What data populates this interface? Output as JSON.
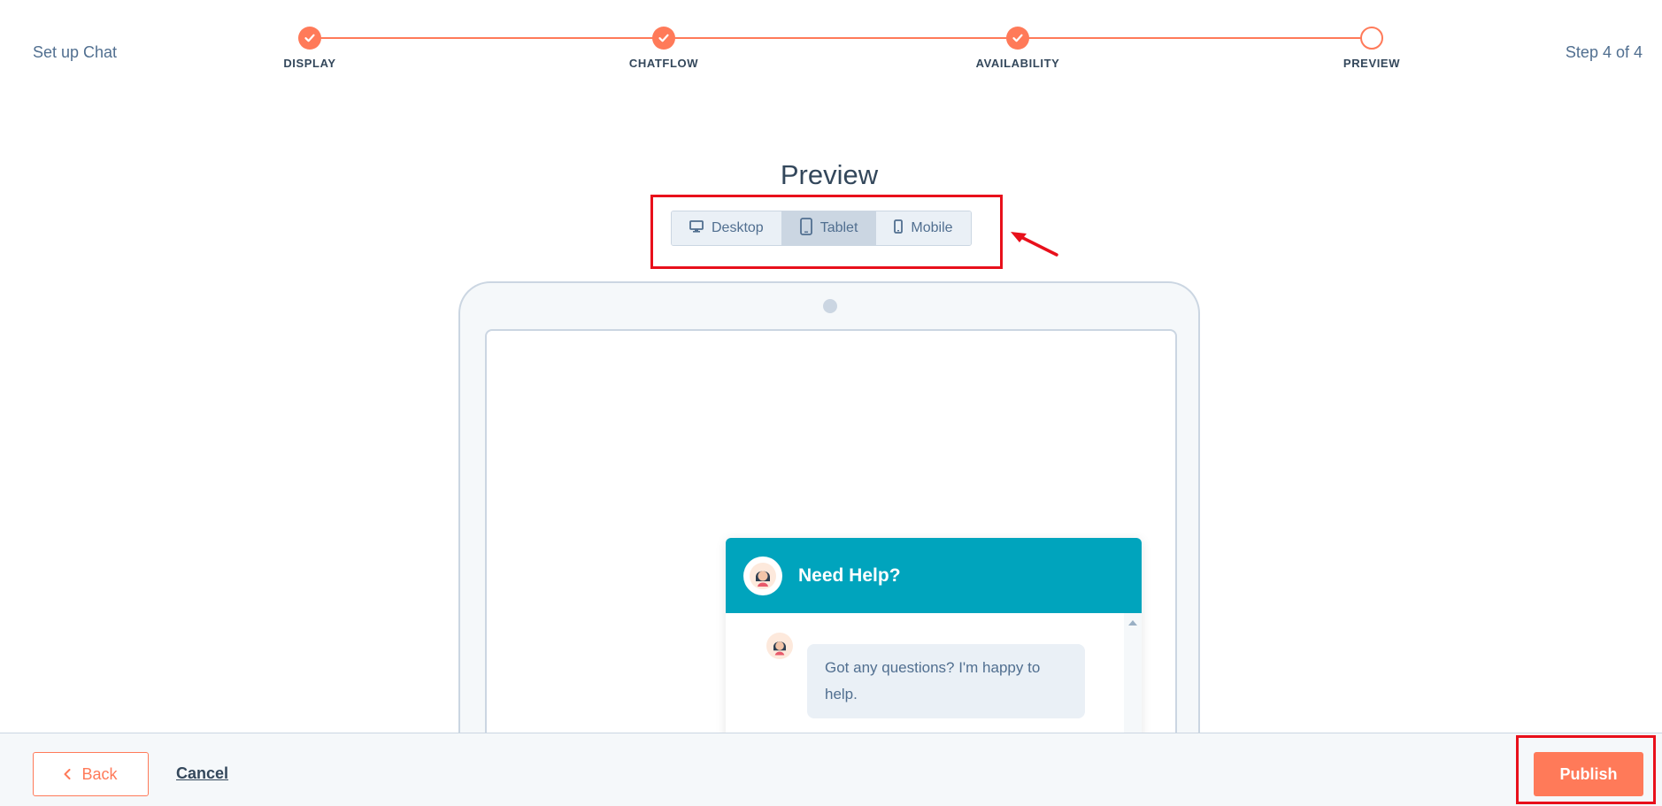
{
  "wizard": {
    "title": "Set up Chat",
    "step_count": "Step 4 of 4",
    "steps": [
      {
        "label": "DISPLAY",
        "status": "complete"
      },
      {
        "label": "CHATFLOW",
        "status": "complete"
      },
      {
        "label": "AVAILABILITY",
        "status": "complete"
      },
      {
        "label": "PREVIEW",
        "status": "current"
      }
    ]
  },
  "preview": {
    "title": "Preview",
    "devices": [
      {
        "label": "Desktop",
        "icon": "desktop-icon",
        "selected": false
      },
      {
        "label": "Tablet",
        "icon": "tablet-icon",
        "selected": true
      },
      {
        "label": "Mobile",
        "icon": "mobile-icon",
        "selected": false
      }
    ]
  },
  "chat_widget": {
    "header_title": "Need Help?",
    "message": "Got any questions? I'm happy to help.",
    "header_color": "#00a4bd"
  },
  "footer": {
    "back_label": "Back",
    "cancel_label": "Cancel",
    "publish_label": "Publish"
  },
  "colors": {
    "accent": "#ff7a59",
    "text": "#33475b",
    "annotation": "#e8101b"
  }
}
